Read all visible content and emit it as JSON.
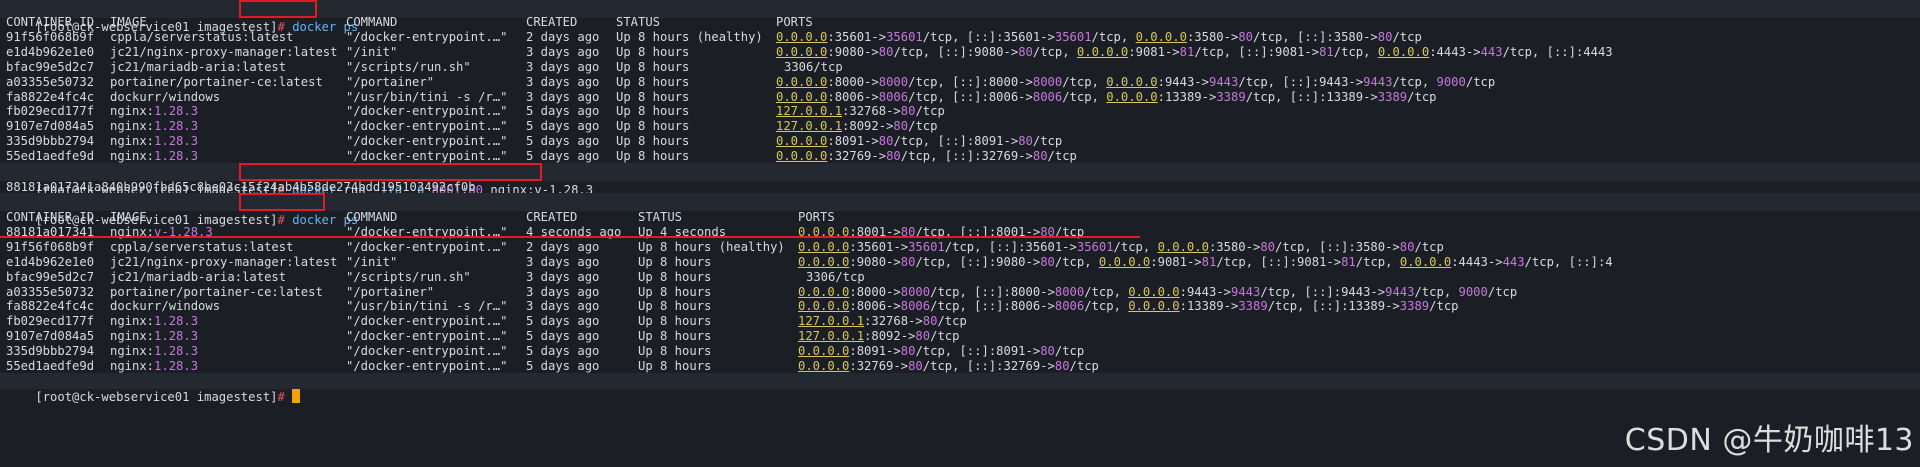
{
  "prompt": "[root@ck-webservice01 imagestest]",
  "hash": "#",
  "commands": {
    "ps1": "docker ps",
    "run_parts": [
      "docker",
      " run ",
      "-itd",
      " ",
      "-p",
      " ",
      "8001",
      ":",
      "80",
      " nginx",
      ":",
      "v-1.28.3"
    ],
    "run_output": "88181a017341a840b990fbd65c8be03c15f24ab4b58de274bdd195103492cf0b",
    "ps2": "docker ps"
  },
  "table_headers": [
    "CONTAINER ID",
    "IMAGE",
    "COMMAND",
    "CREATED",
    "STATUS",
    "PORTS"
  ],
  "table1": [
    {
      "id": "91f56f068b9f",
      "image": "cppla/serverstatus:latest",
      "command": "\"/docker-entrypoint.…\"",
      "created": "2 days ago",
      "status": "Up 8 hours (healthy)",
      "ports": [
        [
          "ip",
          "0.0.0.0"
        ],
        [
          "p",
          ":35601->"
        ],
        [
          "n",
          "35601"
        ],
        [
          "p",
          "/tcp, "
        ],
        [
          "p",
          "[::]:35601->"
        ],
        [
          "n",
          "35601"
        ],
        [
          "p",
          "/tcp, "
        ],
        [
          "ip",
          "0.0.0.0"
        ],
        [
          "p",
          ":3580->"
        ],
        [
          "n",
          "80"
        ],
        [
          "p",
          "/tcp, "
        ],
        [
          "p",
          "[::]:3580->"
        ],
        [
          "n",
          "80"
        ],
        [
          "p",
          "/tcp"
        ]
      ]
    },
    {
      "id": "e1d4b962e1e0",
      "image": "jc21/nginx-proxy-manager:latest",
      "command": "\"/init\"",
      "created": "3 days ago",
      "status": "Up 8 hours",
      "ports": [
        [
          "ip",
          "0.0.0.0"
        ],
        [
          "p",
          ":9080->"
        ],
        [
          "n",
          "80"
        ],
        [
          "p",
          "/tcp, "
        ],
        [
          "p",
          "[::]:9080->"
        ],
        [
          "n",
          "80"
        ],
        [
          "p",
          "/tcp, "
        ],
        [
          "ip",
          "0.0.0.0"
        ],
        [
          "p",
          ":9081->"
        ],
        [
          "n",
          "81"
        ],
        [
          "p",
          "/tcp, "
        ],
        [
          "p",
          "[::]:9081->"
        ],
        [
          "n",
          "81"
        ],
        [
          "p",
          "/tcp, "
        ],
        [
          "ip",
          "0.0.0.0"
        ],
        [
          "p",
          ":4443->"
        ],
        [
          "n",
          "443"
        ],
        [
          "p",
          "/tcp, "
        ],
        [
          "p",
          "[::]:4443"
        ]
      ]
    },
    {
      "id": "bfac99e5d2c7",
      "image": "jc21/mariadb-aria:latest",
      "command": "\"/scripts/run.sh\"",
      "created": "3 days ago",
      "status": "Up 8 hours",
      "ports": [
        [
          "p",
          "3306/tcp"
        ]
      ]
    },
    {
      "id": "a03355e50732",
      "image": "portainer/portainer-ce:latest",
      "command": "\"/portainer\"",
      "created": "3 days ago",
      "status": "Up 8 hours",
      "ports": [
        [
          "ip",
          "0.0.0.0"
        ],
        [
          "p",
          ":8000->"
        ],
        [
          "n",
          "8000"
        ],
        [
          "p",
          "/tcp, "
        ],
        [
          "p",
          "[::]:8000->"
        ],
        [
          "n",
          "8000"
        ],
        [
          "p",
          "/tcp, "
        ],
        [
          "ip",
          "0.0.0.0"
        ],
        [
          "p",
          ":9443->"
        ],
        [
          "n",
          "9443"
        ],
        [
          "p",
          "/tcp, "
        ],
        [
          "p",
          "[::]:9443->"
        ],
        [
          "n",
          "9443"
        ],
        [
          "p",
          "/tcp, "
        ],
        [
          "n",
          "9000"
        ],
        [
          "p",
          "/tcp"
        ]
      ]
    },
    {
      "id": "fa8822e4fc4c",
      "image": "dockurr/windows",
      "command": "\"/usr/bin/tini -s /r…\"",
      "created": "3 days ago",
      "status": "Up 8 hours",
      "ports": [
        [
          "ip",
          "0.0.0.0"
        ],
        [
          "p",
          ":8006->"
        ],
        [
          "n",
          "8006"
        ],
        [
          "p",
          "/tcp, "
        ],
        [
          "p",
          "[::]:8006->"
        ],
        [
          "n",
          "8006"
        ],
        [
          "p",
          "/tcp, "
        ],
        [
          "ip",
          "0.0.0.0"
        ],
        [
          "p",
          ":13389->"
        ],
        [
          "n",
          "3389"
        ],
        [
          "p",
          "/tcp, "
        ],
        [
          "p",
          "[::]:13389->"
        ],
        [
          "n",
          "3389"
        ],
        [
          "p",
          "/tcp"
        ]
      ]
    },
    {
      "id": "fb029ecd177f",
      "image": "nginx:1.28.3",
      "command": "\"/docker-entrypoint.…\"",
      "created": "5 days ago",
      "status": "Up 8 hours",
      "ports": [
        [
          "ip",
          "127.0.0.1"
        ],
        [
          "p",
          ":32768->"
        ],
        [
          "n",
          "80"
        ],
        [
          "p",
          "/tcp"
        ]
      ]
    },
    {
      "id": "9107e7d084a5",
      "image": "nginx:1.28.3",
      "command": "\"/docker-entrypoint.…\"",
      "created": "5 days ago",
      "status": "Up 8 hours",
      "ports": [
        [
          "ip",
          "127.0.0.1"
        ],
        [
          "p",
          ":8092->"
        ],
        [
          "n",
          "80"
        ],
        [
          "p",
          "/tcp"
        ]
      ]
    },
    {
      "id": "335d9bbb2794",
      "image": "nginx:1.28.3",
      "command": "\"/docker-entrypoint.…\"",
      "created": "5 days ago",
      "status": "Up 8 hours",
      "ports": [
        [
          "ip",
          "0.0.0.0"
        ],
        [
          "p",
          ":8091->"
        ],
        [
          "n",
          "80"
        ],
        [
          "p",
          "/tcp, "
        ],
        [
          "p",
          "[::]:8091->"
        ],
        [
          "n",
          "80"
        ],
        [
          "p",
          "/tcp"
        ]
      ]
    },
    {
      "id": "55ed1aedfe9d",
      "image": "nginx:1.28.3",
      "command": "\"/docker-entrypoint.…\"",
      "created": "5 days ago",
      "status": "Up 8 hours",
      "ports": [
        [
          "ip",
          "0.0.0.0"
        ],
        [
          "p",
          ":32769->"
        ],
        [
          "n",
          "80"
        ],
        [
          "p",
          "/tcp, "
        ],
        [
          "p",
          "[::]:32769->"
        ],
        [
          "n",
          "80"
        ],
        [
          "p",
          "/tcp"
        ]
      ]
    }
  ],
  "table2": [
    {
      "id": "88181a017341",
      "image": "nginx:v-1.28.3",
      "command": "\"/docker-entrypoint.…\"",
      "created": "4 seconds ago",
      "status": "Up 4 seconds",
      "ports": [
        [
          "ip",
          "0.0.0.0"
        ],
        [
          "p",
          ":8001->"
        ],
        [
          "n",
          "80"
        ],
        [
          "p",
          "/tcp, "
        ],
        [
          "p",
          "[::]:8001->"
        ],
        [
          "n",
          "80"
        ],
        [
          "p",
          "/tcp"
        ]
      ]
    },
    {
      "id": "91f56f068b9f",
      "image": "cppla/serverstatus:latest",
      "command": "\"/docker-entrypoint.…\"",
      "created": "2 days ago",
      "status": "Up 8 hours (healthy)",
      "ports": [
        [
          "ip",
          "0.0.0.0"
        ],
        [
          "p",
          ":35601->"
        ],
        [
          "n",
          "35601"
        ],
        [
          "p",
          "/tcp, "
        ],
        [
          "p",
          "[::]:35601->"
        ],
        [
          "n",
          "35601"
        ],
        [
          "p",
          "/tcp, "
        ],
        [
          "ip",
          "0.0.0.0"
        ],
        [
          "p",
          ":3580->"
        ],
        [
          "n",
          "80"
        ],
        [
          "p",
          "/tcp, "
        ],
        [
          "p",
          "[::]:3580->"
        ],
        [
          "n",
          "80"
        ],
        [
          "p",
          "/tcp"
        ]
      ]
    },
    {
      "id": "e1d4b962e1e0",
      "image": "jc21/nginx-proxy-manager:latest",
      "command": "\"/init\"",
      "created": "3 days ago",
      "status": "Up 8 hours",
      "ports": [
        [
          "ip",
          "0.0.0.0"
        ],
        [
          "p",
          ":9080->"
        ],
        [
          "n",
          "80"
        ],
        [
          "p",
          "/tcp, "
        ],
        [
          "p",
          "[::]:9080->"
        ],
        [
          "n",
          "80"
        ],
        [
          "p",
          "/tcp, "
        ],
        [
          "ip",
          "0.0.0.0"
        ],
        [
          "p",
          ":9081->"
        ],
        [
          "n",
          "81"
        ],
        [
          "p",
          "/tcp, "
        ],
        [
          "p",
          "[::]:9081->"
        ],
        [
          "n",
          "81"
        ],
        [
          "p",
          "/tcp, "
        ],
        [
          "ip",
          "0.0.0.0"
        ],
        [
          "p",
          ":4443->"
        ],
        [
          "n",
          "443"
        ],
        [
          "p",
          "/tcp, "
        ],
        [
          "p",
          "[::]:4"
        ]
      ]
    },
    {
      "id": "bfac99e5d2c7",
      "image": "jc21/mariadb-aria:latest",
      "command": "\"/scripts/run.sh\"",
      "created": "3 days ago",
      "status": "Up 8 hours",
      "ports": [
        [
          "p",
          "3306/tcp"
        ]
      ]
    },
    {
      "id": "a03355e50732",
      "image": "portainer/portainer-ce:latest",
      "command": "\"/portainer\"",
      "created": "3 days ago",
      "status": "Up 8 hours",
      "ports": [
        [
          "ip",
          "0.0.0.0"
        ],
        [
          "p",
          ":8000->"
        ],
        [
          "n",
          "8000"
        ],
        [
          "p",
          "/tcp, "
        ],
        [
          "p",
          "[::]:8000->"
        ],
        [
          "n",
          "8000"
        ],
        [
          "p",
          "/tcp, "
        ],
        [
          "ip",
          "0.0.0.0"
        ],
        [
          "p",
          ":9443->"
        ],
        [
          "n",
          "9443"
        ],
        [
          "p",
          "/tcp, "
        ],
        [
          "p",
          "[::]:9443->"
        ],
        [
          "n",
          "9443"
        ],
        [
          "p",
          "/tcp, "
        ],
        [
          "n",
          "9000"
        ],
        [
          "p",
          "/tcp"
        ]
      ]
    },
    {
      "id": "fa8822e4fc4c",
      "image": "dockurr/windows",
      "command": "\"/usr/bin/tini -s /r…\"",
      "created": "3 days ago",
      "status": "Up 8 hours",
      "ports": [
        [
          "ip",
          "0.0.0.0"
        ],
        [
          "p",
          ":8006->"
        ],
        [
          "n",
          "8006"
        ],
        [
          "p",
          "/tcp, "
        ],
        [
          "p",
          "[::]:8006->"
        ],
        [
          "n",
          "8006"
        ],
        [
          "p",
          "/tcp, "
        ],
        [
          "ip",
          "0.0.0.0"
        ],
        [
          "p",
          ":13389->"
        ],
        [
          "n",
          "3389"
        ],
        [
          "p",
          "/tcp, "
        ],
        [
          "p",
          "[::]:13389->"
        ],
        [
          "n",
          "3389"
        ],
        [
          "p",
          "/tcp"
        ]
      ]
    },
    {
      "id": "fb029ecd177f",
      "image": "nginx:1.28.3",
      "command": "\"/docker-entrypoint.…\"",
      "created": "5 days ago",
      "status": "Up 8 hours",
      "ports": [
        [
          "ip",
          "127.0.0.1"
        ],
        [
          "p",
          ":32768->"
        ],
        [
          "n",
          "80"
        ],
        [
          "p",
          "/tcp"
        ]
      ]
    },
    {
      "id": "9107e7d084a5",
      "image": "nginx:1.28.3",
      "command": "\"/docker-entrypoint.…\"",
      "created": "5 days ago",
      "status": "Up 8 hours",
      "ports": [
        [
          "ip",
          "127.0.0.1"
        ],
        [
          "p",
          ":8092->"
        ],
        [
          "n",
          "80"
        ],
        [
          "p",
          "/tcp"
        ]
      ]
    },
    {
      "id": "335d9bbb2794",
      "image": "nginx:1.28.3",
      "command": "\"/docker-entrypoint.…\"",
      "created": "5 days ago",
      "status": "Up 8 hours",
      "ports": [
        [
          "ip",
          "0.0.0.0"
        ],
        [
          "p",
          ":8091->"
        ],
        [
          "n",
          "80"
        ],
        [
          "p",
          "/tcp, "
        ],
        [
          "p",
          "[::]:8091->"
        ],
        [
          "n",
          "80"
        ],
        [
          "p",
          "/tcp"
        ]
      ]
    },
    {
      "id": "55ed1aedfe9d",
      "image": "nginx:1.28.3",
      "command": "\"/docker-entrypoint.…\"",
      "created": "5 days ago",
      "status": "Up 8 hours",
      "ports": [
        [
          "ip",
          "0.0.0.0"
        ],
        [
          "p",
          ":32769->"
        ],
        [
          "n",
          "80"
        ],
        [
          "p",
          "/tcp, "
        ],
        [
          "p",
          "[::]:32769->"
        ],
        [
          "n",
          "80"
        ],
        [
          "p",
          "/tcp"
        ]
      ]
    }
  ],
  "watermark": "CSDN @牛奶咖啡13",
  "colors": {
    "background": "#1b1e24",
    "prompt_bg": "#242830",
    "command": "#5fb6f5",
    "ip": "#d7c95a",
    "port_number": "#c678dd",
    "highlight": "#e01b24",
    "cursor": "#f0a30a"
  }
}
